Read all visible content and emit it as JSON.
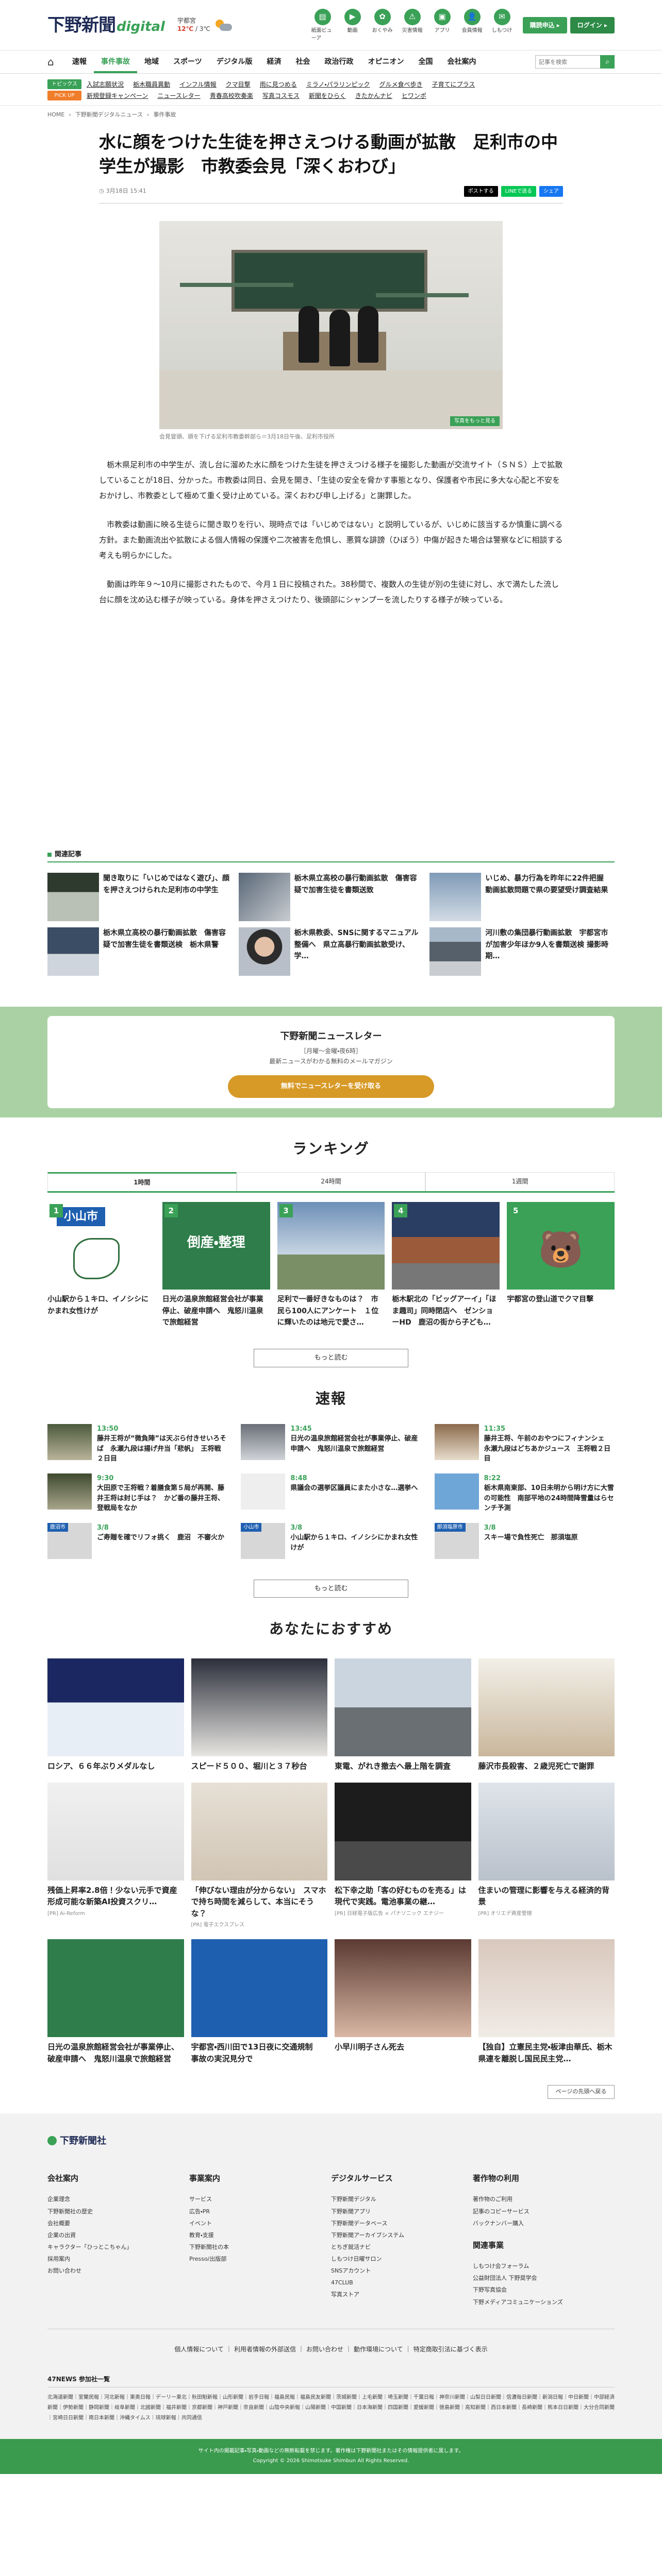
{
  "header": {
    "logo_main": "下野新聞",
    "logo_sub": "digital",
    "weather_city": "宇都宮",
    "weather_temp": "12℃",
    "weather_temp2": "3℃",
    "icons": [
      {
        "label": "紙面ビューア",
        "glyph": "▤"
      },
      {
        "label": "動画",
        "glyph": "▶"
      },
      {
        "label": "おくやみ",
        "glyph": "✿"
      },
      {
        "label": "災害情報",
        "glyph": "⚠"
      },
      {
        "label": "アプリ",
        "glyph": "▣"
      },
      {
        "label": "会員情報",
        "glyph": "👤"
      },
      {
        "label": "しもつけ",
        "glyph": "✉"
      }
    ],
    "register_label": "購読申込 ▸",
    "login_label": "ログイン ▸"
  },
  "nav": {
    "items": [
      "速報",
      "事件事故",
      "地域",
      "スポーツ",
      "デジタル版",
      "経済",
      "社会",
      "政治行政",
      "オピニオン",
      "全国",
      "会社案内"
    ],
    "active_index": 1,
    "search_placeholder": "記事を検索"
  },
  "topics": {
    "label1": "トピックス",
    "row1": [
      "入試志願状況",
      "栃木職員異動",
      "インフル情報",
      "クマ目撃",
      "雨に見つめる",
      "ミラノ・パラリンピック",
      "グルメ食べ歩き",
      "子育てにプラス"
    ],
    "label2": "PICK UP",
    "row2": [
      "新規登録キャンペーン",
      "ニュースレター",
      "青春高校吹奏楽",
      "写真コスモス",
      "新聞をひらく",
      "きたかんナビ",
      "ヒワンポ"
    ]
  },
  "breadcrumb": [
    "HOME",
    "下野新聞デジタルニュース",
    "事件事故"
  ],
  "article": {
    "title": "水に顔をつけた生徒を押さえつける動画が拡散　足利市の中学生が撮影　市教委会見「深くおわび」",
    "date": "3月18日 15:41",
    "share": [
      "ポストする",
      "LINEで送る",
      "シェア"
    ],
    "photo_tag": "写真をもっと見る",
    "caption": "会見冒頭、頭を下げる足利市教委幹部ら＝3月18日午後、足利市役所",
    "paragraphs": [
      "栃木県足利市の中学生が、流し台に溜めた水に顔をつけた生徒を押さえつける様子を撮影した動画が交流サイト（ＳＮＳ）上で拡散していることが18日、分かった。市教委は同日、会見を開き、「生徒の安全を脅かす事態となり、保護者や市民に多大な心配と不安をおかけし、市教委として極めて重く受け止めている。深くおわび申し上げる」と謝罪した。",
      "市教委は動画に映る生徒らに聞き取りを行い、現時点では「いじめではない」と説明しているが、いじめに該当するか慎重に調べる方針。また動画流出や拡散による個人情報の保護や二次被害を危惧し、悪質な誹謗（ひぼう）中傷が起きた場合は警察などに相談する考えも明らかにした。",
      "動画は昨年９～10月に撮影されたもので、今月１日に投稿された。38秒間で、複数人の生徒が別の生徒に対し、水で満たした流し台に顔を沈め込む様子が映っている。身体を押さえつけたり、後頭部にシャンプーを流したりする様子が映っている。"
    ]
  },
  "related": {
    "heading": "関連記事",
    "items": [
      "聞き取りに「いじめではなく遊び」、顔を押さえつけられた足利市の中学生",
      "栃木県立高校の暴行動画拡散　傷害容疑で加害生徒を書類送致",
      "いじめ、暴力行為を昨年に22件把握　動画拡散問題で県の要望受け調査結果",
      "栃木県立高校の暴行動画拡散　傷害容疑で加害生徒を書類送検　栃木県警",
      "栃木県教委、SNSに関するマニュアル整備へ　県立高暴行動画拡散受け、学…",
      "河川敷の集団暴行動画拡散　宇都宮市が加害少年ほか9人を書類送検 撮影時期…"
    ]
  },
  "newsletter": {
    "title": "下野新聞ニュースレター",
    "sub1": "［月曜～金曜・夜6時］",
    "sub2": "最新ニュースがわかる無料のメールマガジン",
    "button": "無料でニュースレターを受け取る"
  },
  "ranking": {
    "heading": "ランキング",
    "tabs": [
      "1時間",
      "24時間",
      "1週間"
    ],
    "items": [
      {
        "rank": "1",
        "text": "小山駅から１キロ、イノシシにかまれ女性けが",
        "tag": "小山市"
      },
      {
        "rank": "2",
        "text": "日光の温泉旅館経営会社が事業停止、破産申請へ　鬼怒川温泉で旅館経営",
        "tag": "倒産・整理"
      },
      {
        "rank": "3",
        "text": "足利で一番好きなものは？　市民ら100人にアンケート　１位に輝いたのは地元で愛さ…",
        "tag": ""
      },
      {
        "rank": "4",
        "text": "栃木駅北の「ビッグアーイ」「ほま趣司」同時閉店へ　ゼンショーHD　鹿沼の街から子ども…",
        "tag": ""
      },
      {
        "rank": "5",
        "text": "宇都宮の登山道でクマ目撃",
        "tag": ""
      }
    ],
    "more": "もっと読む"
  },
  "sokuho": {
    "heading": "速報",
    "items": [
      {
        "time": "13:50",
        "text": "藤井王将が“微負陣”は天ぶら付きせいろそば　永瀬九段は揚げ弁当「悲帆」　王将戦２日目"
      },
      {
        "time": "13:45",
        "text": "日光の温泉旅館経営会社が事業停止、破産申請へ　鬼怒川温泉で旅館経営"
      },
      {
        "time": "11:35",
        "text": "藤井王将、午前のおやつにフィナンシェ　永瀬九段はどちあかジュース　王将戦２日目"
      },
      {
        "time": "9:30",
        "text": "大田原で王将戦？着膳食第５局が再開、藤井王将は封じ手は？　かど番の藤井王将、登戦局をなか"
      },
      {
        "time": "8:48",
        "text": "県議会の選挙区議員にまた小さな…選挙へ"
      },
      {
        "time": "8:22",
        "text": "栃木県南東部、10日未明から明け方に大雪の可能性　南部平地の24時間降雪量はらセンチ予測"
      },
      {
        "time": "3/8",
        "tag": "鹿沼市",
        "text": "ご寿贈を確でリフォ挑く　鹿沼　不審火か"
      },
      {
        "time": "3/8",
        "tag": "小山市",
        "text": "小山駅から１キロ、イノシシにかまれ女性けが"
      },
      {
        "time": "3/8",
        "tag": "那須塩原市",
        "text": "スキー場で負性死亡　那須塩原"
      }
    ],
    "more": "もっと読む"
  },
  "osusume": {
    "heading": "あなたにおすすめ",
    "items": [
      {
        "text": "ロシア、６６年ぶりメダルなし",
        "src": ""
      },
      {
        "text": "スピード５００、堀川と３７秒台",
        "src": ""
      },
      {
        "text": "東電、がれき撤去へ最上階を調査",
        "src": ""
      },
      {
        "text": "藤沢市長殺害、２歳児死亡で謝罪",
        "src": ""
      },
      {
        "text": "残価上昇率2.8倍！少ない元手で資産形成可能な新築AI投資スクリ…",
        "src": "[PR] Ai-Reform"
      },
      {
        "text": "「伸びない理由が分からない」　スマホで持ち時間を減らして、本当にそうな？",
        "src": "[PR] 電子エクスプレス"
      },
      {
        "text": "松下幸之助「客の好むものを売る」は現代で実践。電池事業の継…",
        "src": "[PR] 日経電子版広告 × パナソニック エナジー"
      },
      {
        "text": "住まいの管理に影響を与える経済的背景",
        "src": "[PR] オリエデ資産管理"
      },
      {
        "text": "日光の温泉旅館経営会社が事業停止、破産申請へ　鬼怒川温泉で旅館経営",
        "src": ""
      },
      {
        "text": "宇都宮・西川田で13日夜に交通規制　事故の実況見分で",
        "src": ""
      },
      {
        "text": "小早川明子さん死去",
        "src": ""
      },
      {
        "text": "【独自】立憲民主党・板津由華氏、栃木県連を離脱し国民民主党…",
        "src": ""
      }
    ],
    "page_top": "ページの先頭へ戻る"
  },
  "footer": {
    "logo": "下野新聞社",
    "col1": {
      "h": "会社案内",
      "items": [
        "企業理念",
        "下野新聞社の歴史",
        "会社概要",
        "企業の出資",
        "キャラクター「ひっとこちゃん」",
        "採用案内",
        "お問い合わせ"
      ]
    },
    "col2": {
      "h": "事業案内",
      "items": [
        "サービス",
        "広告・PR",
        "イベント",
        "教育・支援",
        "下野新聞社の本",
        "Presso/出版部"
      ]
    },
    "col3": {
      "h": "デジタルサービス",
      "items": [
        "下野新聞デジタル",
        "下野新聞アプリ",
        "下野新聞データベース",
        "下野新聞アーカイブシステム",
        "とちぎ就活ナビ",
        "しもつけ日曜サロン",
        "SNSアカウント",
        "47CLUB",
        "写真ストア"
      ]
    },
    "col4": {
      "h": "著作物の利用",
      "items": [
        "著作物のご利用",
        "記事のコピーサービス",
        "バックナンバー購入"
      ],
      "h2": "関連事業",
      "items2": [
        "しもつけ会フォーラム",
        "公益財団法人 下野奨学会",
        "下野写真協会",
        "下野メディアコミュニケーションズ"
      ]
    },
    "links": [
      "個人情報について",
      "利用者情報の外部送信",
      "お問い合わせ",
      "動作環境について",
      "特定商取引法に基づく表示"
    ],
    "sisters_h": "47NEWS 参加社一覧",
    "sisters": "北海道新聞｜室蘭民報｜河北新報｜東奥日報｜デーリー東北｜秋田魁新報｜山形新聞｜岩手日報｜福島民報｜福島民友新聞｜茨城新聞｜上毛新聞｜埼玉新聞｜千葉日報｜神奈川新聞｜山梨日日新聞｜信濃毎日新聞｜新潟日報｜中日新聞｜中部経済新聞｜伊勢新聞｜静岡新聞｜岐阜新聞｜北國新聞｜福井新聞｜京都新聞｜神戸新聞｜奈良新聞｜山陰中央新報｜山陽新聞｜中国新聞｜日本海新聞｜四国新聞｜愛媛新聞｜徳島新聞｜高知新聞｜西日本新聞｜長崎新聞｜熊本日日新聞｜大分合同新聞｜宮崎日日新聞｜南日本新聞｜沖縄タイムス｜琉球新報｜共同通信",
    "copy1": "サイト内の掲載記事・写真・動画などの無断転載を禁じます。著作権は下野新聞社またはその情報提供者に属します。",
    "copy2": "Copyright © 2026 Shimotsuke Shimbun All Rights Reserved."
  },
  "colors": {
    "brand_green": "#3aa157",
    "navy": "#1e2a55",
    "orange": "#d79a27"
  }
}
